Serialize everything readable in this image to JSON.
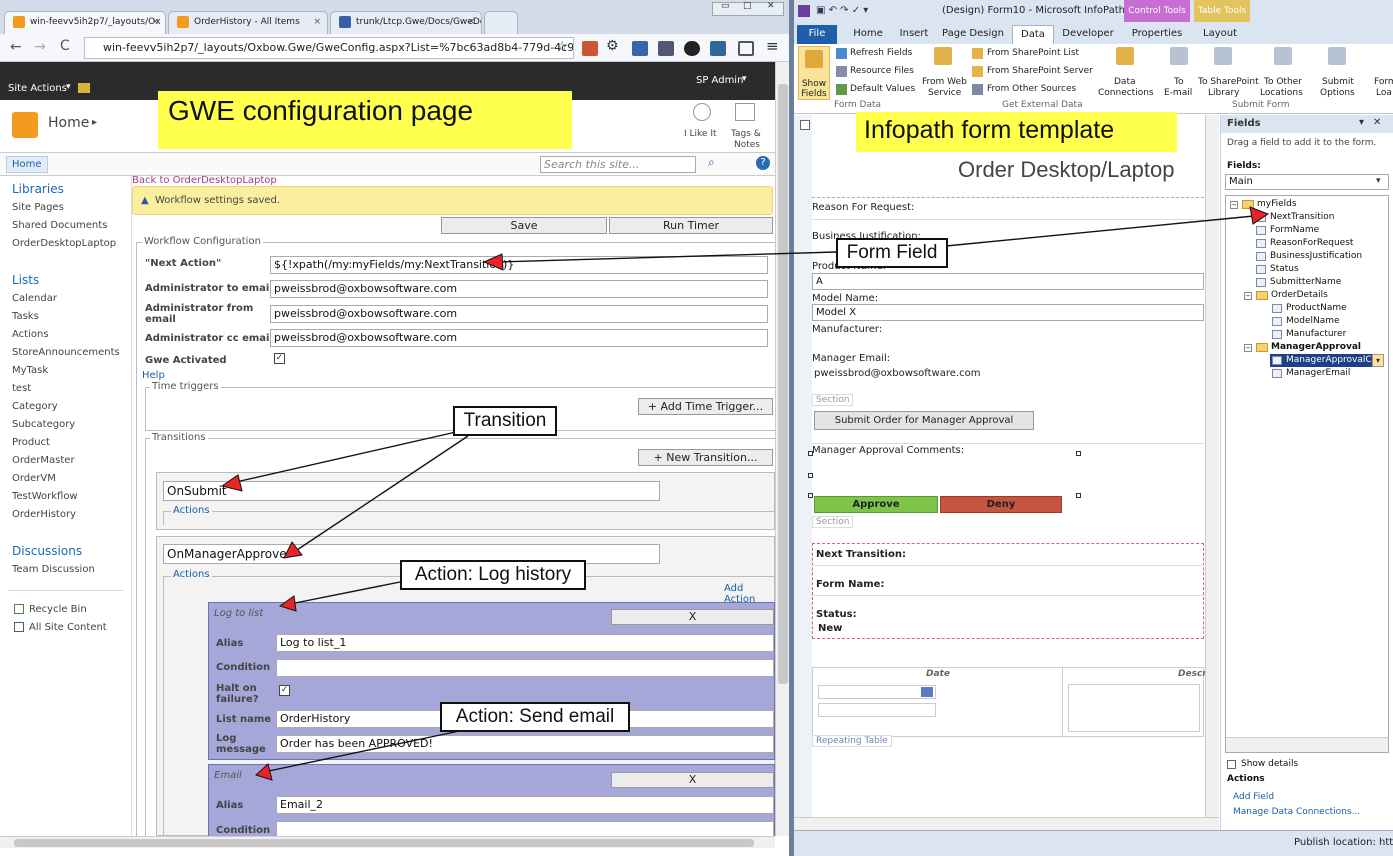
{
  "browser": {
    "tabs": [
      "win-feevv5ih2p7/_layouts/Ox",
      "OrderHistory - All Items",
      "trunk/Ltcp.Gwe/Docs/GweDe"
    ],
    "url": "win-feevv5ih2p7/_layouts/Oxbow.Gwe/GweConfig.aspx?List=%7bc63ad8b4-779d-4c96-"
  },
  "sp": {
    "site_actions": "Site Actions",
    "user": "SP Admin",
    "home": "Home",
    "like": "I Like It",
    "tags1": "Tags &",
    "tags2": "Notes",
    "home_tab": "Home",
    "search_placeholder": "Search this site...",
    "banner": "GWE configuration page",
    "nav": {
      "libraries": "Libraries",
      "lib_items": [
        "Site Pages",
        "Shared Documents",
        "OrderDesktopLaptop"
      ],
      "lists": "Lists",
      "list_items": [
        "Calendar",
        "Tasks",
        "Actions",
        "StoreAnnouncements",
        "MyTask",
        "test",
        "Category",
        "Subcategory",
        "Product",
        "OrderMaster",
        "OrderVM",
        "TestWorkflow",
        "OrderHistory"
      ],
      "discussions": "Discussions",
      "disc_items": [
        "Team Discussion"
      ],
      "recycle": "Recycle Bin",
      "all_content": "All Site Content"
    },
    "back_link": "Back to OrderDesktopLaptop",
    "saved_msg": "Workflow settings saved.",
    "save": "Save",
    "run_timer": "Run Timer",
    "wf_config": "Workflow Configuration",
    "next_action_label": "\"Next Action\"",
    "next_action_value": "${!xpath(/my:myFields/my:NextTransition)}",
    "admin_to_label": "Administrator to email",
    "admin_to_value": "pweissbrod@oxbowsoftware.com",
    "admin_from_label1": "Administrator from",
    "admin_from_label2": "email",
    "admin_from_value": "pweissbrod@oxbowsoftware.com",
    "admin_cc_label": "Administrator cc email",
    "admin_cc_value": "pweissbrod@oxbowsoftware.com",
    "gwe_activated": "Gwe Activated",
    "help": "Help",
    "time_triggers": "Time triggers",
    "add_time_trigger": "+ Add Time Trigger...",
    "transitions": "Transitions",
    "new_transition": "+ New Transition...",
    "t1_name": "OnSubmit",
    "actions": "Actions",
    "t2_name": "OnManagerApprove",
    "add_action": "Add Action",
    "a1_type": "Log to list",
    "x": "X",
    "alias": "Alias",
    "a1_alias": "Log to list_1",
    "condition": "Condition",
    "halt1": "Halt on",
    "halt2": "failure?",
    "list_name": "List name",
    "a1_list": "OrderHistory",
    "log1": "Log",
    "log2": "message",
    "a1_msg": "Order has been APPROVED!",
    "a2_type": "Email",
    "a2_alias": "Email_2"
  },
  "callouts": {
    "form_field": "Form Field",
    "transition": "Transition",
    "log_history": "Action: Log history",
    "send_email": "Action: Send email"
  },
  "infopath": {
    "title": "(Design) Form10  -  Microsoft InfoPath",
    "ctx1": "Control Tools",
    "ctx2": "Table Tools",
    "tabs": [
      "File",
      "Home",
      "Insert",
      "Page Design",
      "Data",
      "Developer",
      "Properties",
      "Layout"
    ],
    "ribbon": {
      "show_fields1": "Show",
      "show_fields2": "Fields",
      "refresh": "Refresh Fields",
      "resource": "Resource Files",
      "defaults": "Default Values",
      "from_web1": "From Web",
      "from_web2": "Service",
      "from_sp_list": "From SharePoint List",
      "from_sp_server": "From SharePoint Server",
      "from_other": "From Other Sources",
      "data_conn1": "Data",
      "data_conn2": "Connections",
      "to_email1": "To",
      "to_email2": "E-mail",
      "to_sp1": "To SharePoint",
      "to_sp2": "Library",
      "to_other1": "To Other",
      "to_other2": "Locations",
      "submit1": "Submit",
      "submit2": "Options",
      "form_load1": "Form",
      "form_load2": "Loa",
      "grp_form_data": "Form Data",
      "grp_get_ext": "Get External Data",
      "grp_submit": "Submit Form"
    },
    "banner": "Infopath form template",
    "form_title": "Order Desktop/Laptop",
    "reason": "Reason For Request:",
    "business": "Business Justification:",
    "product": "Product Name:",
    "product_val": "A",
    "model": "Model Name:",
    "model_val": "Model X",
    "manufacturer": "Manufacturer:",
    "mgr_email": "Manager Email:",
    "mgr_email_val": "pweissbrod@oxbowsoftware.com",
    "section": "Section",
    "submit_btn": "Submit Order for Manager Approval",
    "mgr_comments": "Manager Approval Comments:",
    "approve": "Approve",
    "deny": "Deny",
    "next_transition": "Next Transition:",
    "form_name": "Form Name:",
    "status": "Status:",
    "status_val": "New",
    "date_col": "Date",
    "desc_col": "Descri",
    "repeating": "Repeating Table",
    "fields_panel": {
      "title": "Fields",
      "hint": "Drag a field to add it to the form.",
      "fields_label": "Fields:",
      "source": "Main",
      "tree": [
        "myFields",
        "NextTransition",
        "FormName",
        "ReasonForRequest",
        "BusinessJustification",
        "Status",
        "SubmitterName",
        "OrderDetails",
        "ProductName",
        "ModelName",
        "Manufacturer",
        "ManagerApproval",
        "ManagerApprovalC",
        "ManagerEmail"
      ],
      "show_details": "Show details",
      "actions": "Actions",
      "add_field": "Add Field",
      "manage": "Manage Data Connections..."
    },
    "status_bar": "Publish location: http:"
  },
  "colors": {
    "accent": "#2a5ca8",
    "yellow": "#ffff4d",
    "approve": "#7ec34a",
    "deny": "#c6553f",
    "action_box": "#a5a7d9"
  }
}
